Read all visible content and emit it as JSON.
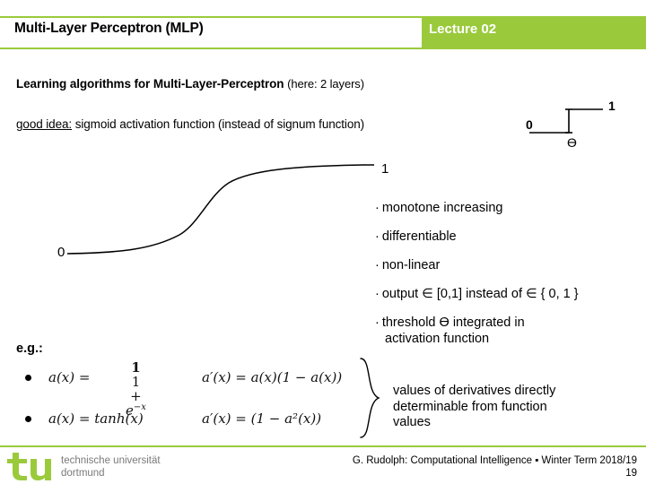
{
  "slide": {
    "title": "Multi-Layer Perceptron (MLP)",
    "lecture": "Lecture 02",
    "accent_color": "#9ACA3C"
  },
  "heading": {
    "bold_part": "Learning algorithms for Multi-Layer-Perceptron",
    "sub_part": "(here: 2 layers)"
  },
  "good_idea": {
    "label": "good idea:",
    "text": "sigmoid activation function (instead of signum function)"
  },
  "step_figure": {
    "label_zero": "0",
    "label_one": "1",
    "label_theta": "ϴ"
  },
  "sigmoid_figure": {
    "label_zero": "0",
    "label_one": "1"
  },
  "bullets": [
    {
      "dot": "·",
      "text": "monotone increasing"
    },
    {
      "dot": "·",
      "text": "differentiable"
    },
    {
      "dot": "·",
      "text": "non-linear"
    },
    {
      "dot": "·",
      "text": "output ∈ [0,1] instead of ∈ { 0, 1 }"
    },
    {
      "dot": "·",
      "text": "threshold ϴ integrated in",
      "text2": "activation function"
    }
  ],
  "examples": {
    "label": "e.g.:",
    "rows": [
      {
        "lhs": "a(x) =",
        "frac_num": "1",
        "frac_den_prefix": "1 + ",
        "frac_den_base": "e",
        "frac_den_sup": "−x",
        "rhs": "a′(x) = a(x)(1 − a(x))"
      },
      {
        "lhs": "a(x) = tanh(x)",
        "rhs": "a′(x) = (1 − a²(x))"
      }
    ]
  },
  "note": {
    "line1": "values of derivatives directly",
    "line2": "determinable from function",
    "line3": "values"
  },
  "footer": {
    "university_line1": "technische universität",
    "university_line2": "dortmund",
    "logo_text": "tu",
    "credit": "G. Rudolph: Computational Intelligence ▪ Winter Term 2018/19",
    "page": "19"
  }
}
